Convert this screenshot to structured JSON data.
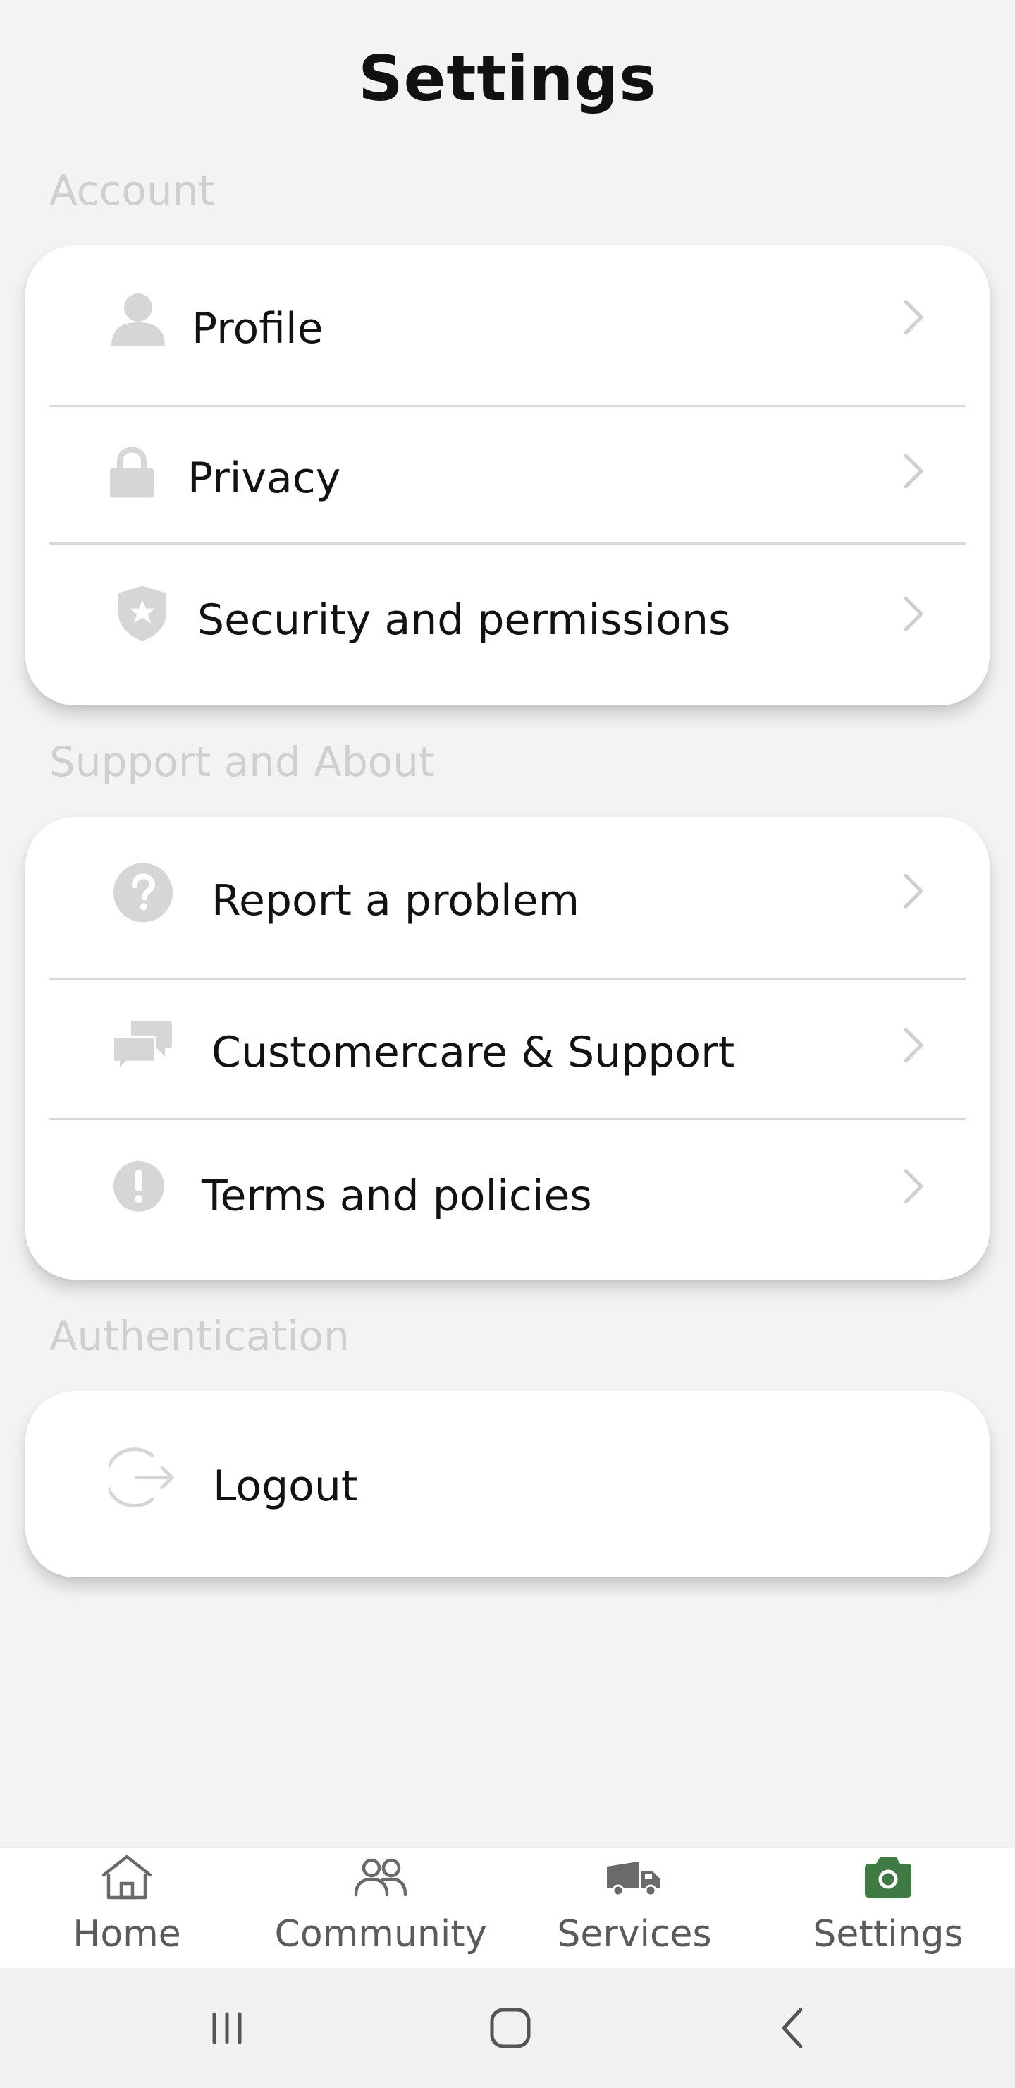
{
  "header": {
    "title": "Settings"
  },
  "sections": {
    "account": {
      "heading": "Account",
      "items": [
        {
          "label": "Profile",
          "icon": "person-icon"
        },
        {
          "label": "Privacy",
          "icon": "lock-icon"
        },
        {
          "label": "Security and permissions",
          "icon": "shield-icon"
        }
      ]
    },
    "support": {
      "heading": "Support and About",
      "items": [
        {
          "label": "Report a problem",
          "icon": "question-circle-icon"
        },
        {
          "label": "Customercare & Support",
          "icon": "chat-bubbles-icon"
        },
        {
          "label": "Terms and policies",
          "icon": "exclamation-circle-icon"
        }
      ]
    },
    "authentication": {
      "heading": "Authentication",
      "items": [
        {
          "label": "Logout",
          "icon": "logout-icon"
        }
      ]
    }
  },
  "bottom_nav": {
    "items": [
      {
        "label": "Home",
        "icon": "home-icon"
      },
      {
        "label": "Community",
        "icon": "community-icon"
      },
      {
        "label": "Services",
        "icon": "truck-icon"
      },
      {
        "label": "Settings",
        "icon": "camera-settings-icon",
        "active": true
      }
    ]
  },
  "colors": {
    "background": "#f3f3f3",
    "card": "#ffffff",
    "section_heading": "#cfcfcf",
    "row_icon": "#d6d6d6",
    "text": "#121212",
    "nav_inactive": "#5b5b5b",
    "nav_active": "#3f7a45"
  },
  "system_nav": {
    "buttons": [
      "recent-apps-icon",
      "home-circle-icon",
      "back-icon"
    ]
  }
}
